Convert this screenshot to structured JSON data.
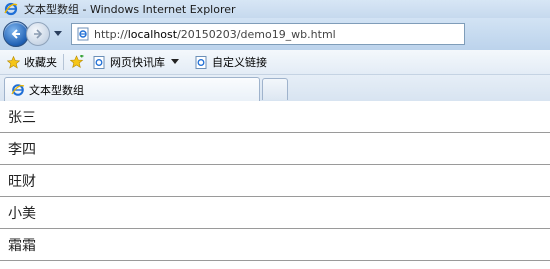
{
  "window": {
    "title": "文本型数组 - Windows Internet Explorer"
  },
  "address_bar": {
    "url_prefix": "http://",
    "url_host": "localhost",
    "url_path": "/20150203/demo19_wb.html"
  },
  "favorites_bar": {
    "favorites_label": "收藏夹",
    "web_slice_label": "网页快讯库",
    "custom_links_label": "自定义链接"
  },
  "tab": {
    "label": "文本型数组"
  },
  "list": [
    "张三",
    "李四",
    "旺财",
    "小美",
    "霜霜"
  ],
  "colors": {
    "titlebar": "#c6d9ee",
    "divider": "#9a9a9a",
    "ie_blue": "#1f6fd6"
  }
}
